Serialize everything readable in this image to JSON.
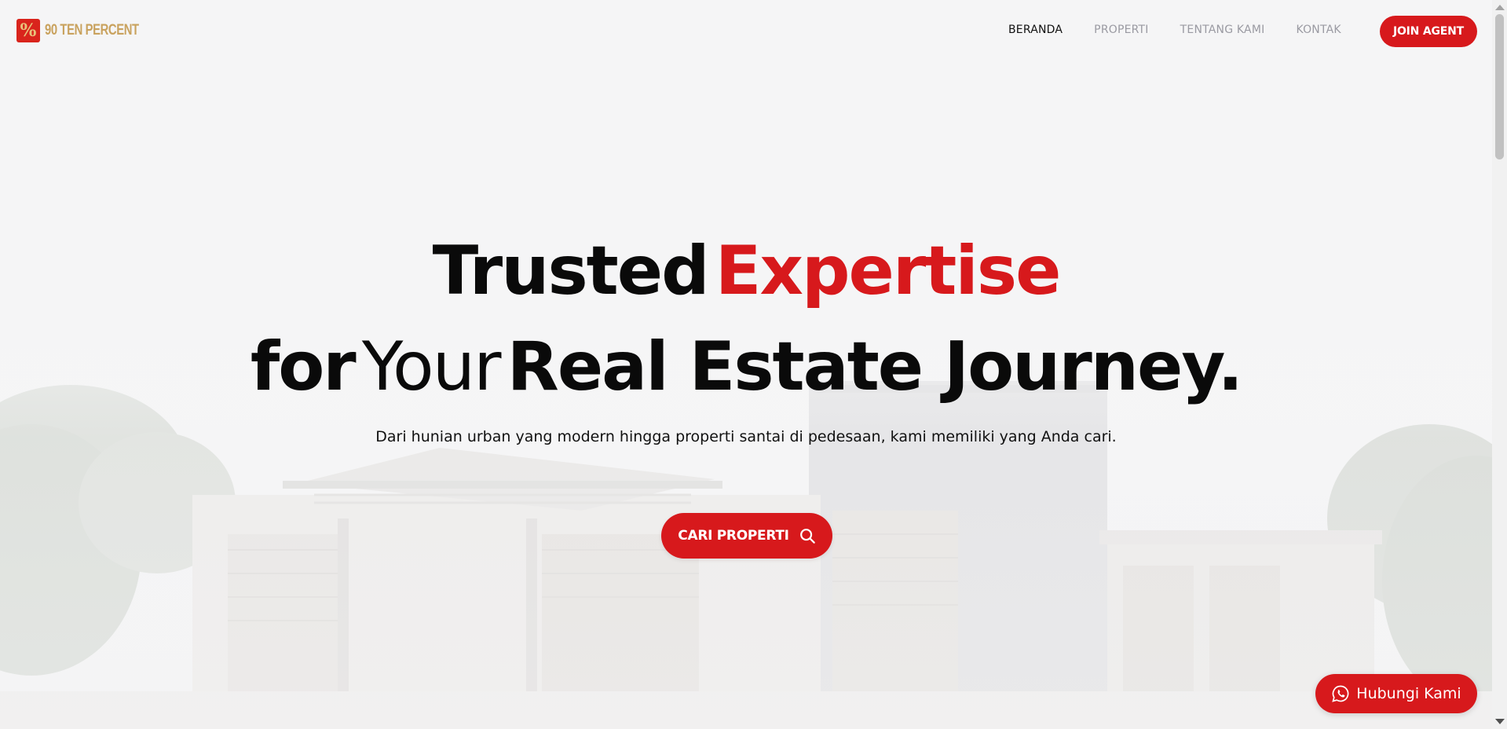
{
  "brand": {
    "logo_glyph": "%",
    "name": "90 TEN PERCENT",
    "color": "#d7191c",
    "logo_text_color": "#c9a25e"
  },
  "nav": {
    "items": [
      {
        "label": "BERANDA",
        "active": true
      },
      {
        "label": "PROPERTI",
        "active": false
      },
      {
        "label": "TENTANG KAMI",
        "active": false
      },
      {
        "label": "KONTAK",
        "active": false
      }
    ],
    "cta_label": "JOIN AGENT"
  },
  "hero": {
    "title_line1_a": "Trusted",
    "title_line1_b": "Expertise",
    "title_line2_a": "for",
    "title_line2_b": "Your",
    "title_line2_c": "Real Estate Journey.",
    "subtitle": "Dari hunian urban yang modern hingga properti santai di pedesaan, kami memiliki yang Anda cari.",
    "cta_label": "CARI PROPERTI",
    "cta_icon": "search-icon"
  },
  "floating": {
    "whatsapp_label": "Hubungi Kami",
    "whatsapp_icon": "whatsapp-icon"
  },
  "colors": {
    "accent": "#d7191c",
    "text": "#0a0a0a",
    "nav_muted": "#9a9aa2"
  }
}
